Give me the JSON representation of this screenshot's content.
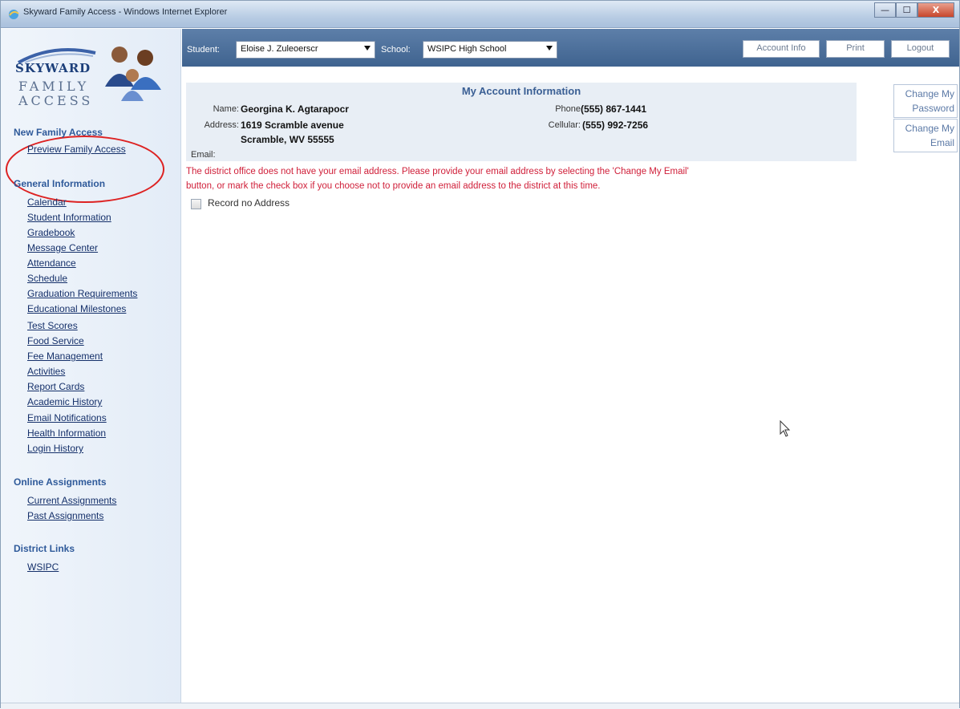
{
  "window": {
    "title": "Skyward Family Access - Windows Internet Explorer",
    "minimize": "—",
    "maximize": "☐",
    "close": "X"
  },
  "logo": {
    "brand": "SKYWARD",
    "line1": "FAMILY",
    "line2": "ACCESS"
  },
  "sidebar": {
    "new_family_access": {
      "heading": "New Family Access",
      "items": [
        "Preview Family Access"
      ]
    },
    "general_information": {
      "heading": "General Information",
      "items": [
        "Calendar",
        "Student Information",
        "Gradebook",
        "Message Center",
        "Attendance",
        "Schedule",
        "Graduation Requirements",
        "Educational Milestones",
        "Test Scores",
        "Food Service",
        "Fee Management",
        "Activities",
        "Report Cards",
        "Academic History",
        "Email Notifications",
        "Health Information",
        "Login History"
      ]
    },
    "online_assignments": {
      "heading": "Online Assignments",
      "items": [
        "Current Assignments",
        "Past Assignments"
      ]
    },
    "district_links": {
      "heading": "District Links",
      "items": [
        "WSIPC"
      ]
    }
  },
  "topbar": {
    "student_label": "Student:",
    "student_value": "Eloise J. Zuleoerscr",
    "school_label": "School:",
    "school_value": "WSIPC High School",
    "account_info": "Account Info",
    "print": "Print",
    "logout": "Logout"
  },
  "account": {
    "title": "My Account Information",
    "name_label": "Name:",
    "name": "Georgina K. Agtarapocr",
    "address_label": "Address:",
    "address_line1": "1619 Scramble avenue",
    "address_line2": "Scramble, WV 55555",
    "email_label": "Email:",
    "phone_label": "Phone",
    "phone": "(555) 867-1441",
    "cell_label": "Cellular:",
    "cell": "(555) 992-7256",
    "change_password": [
      "Change My",
      "Password"
    ],
    "change_email": [
      "Change My",
      "Email"
    ]
  },
  "warning": {
    "line1": "The district office does not have your email address.  Please provide your email address by selecting the 'Change My Email'",
    "line2": "button, or mark the check box if you choose not to provide an email address to the district at this time."
  },
  "checkbox": {
    "label": "Record no Address",
    "checked": false
  },
  "colors": {
    "topbar": "#4a6d98",
    "heading": "#2f5a9a",
    "warning": "#d0203a",
    "highlight_circle": "#dd2222"
  }
}
